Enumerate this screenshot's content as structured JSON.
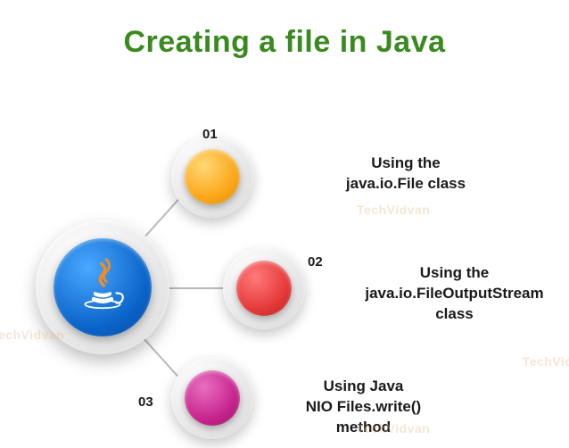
{
  "title": "Creating a file in Java",
  "hub_icon": "java-logo",
  "nodes": [
    {
      "num": "01",
      "color": "#fba81a",
      "desc": "Using the\njava.io.File class"
    },
    {
      "num": "02",
      "color": "#e53a3a",
      "desc": "Using the\njava.io.FileOutputStream\nclass"
    },
    {
      "num": "03",
      "color": "#c7258e",
      "desc": "Using Java\nNIO Files.write()\nmethod"
    }
  ],
  "watermark": "TechVidvan"
}
